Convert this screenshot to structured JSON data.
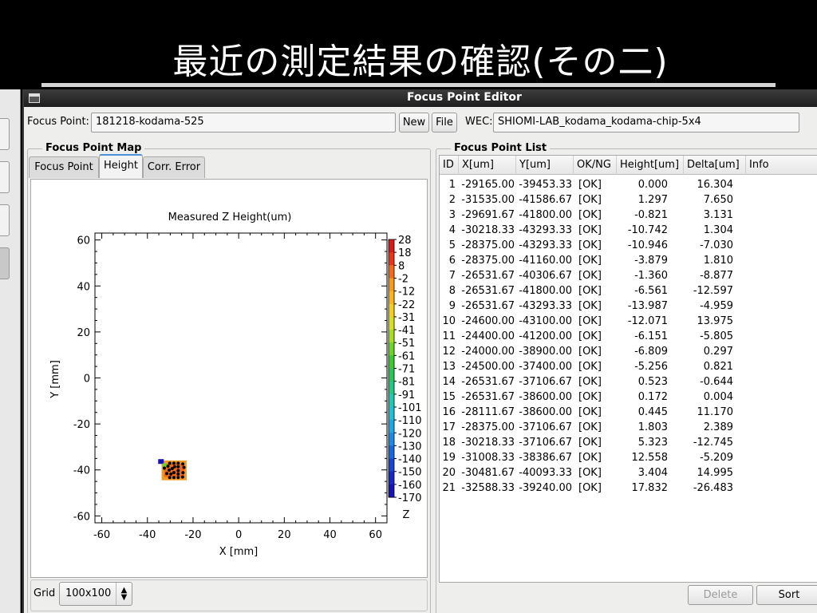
{
  "slide": {
    "title": "最近の測定結果の確認(その二)"
  },
  "window": {
    "title": "Focus Point Editor"
  },
  "toolbar": {
    "focus_point_label": "Focus Point:",
    "focus_point_value": "181218-kodama-525",
    "new_label": "New",
    "file_label": "File",
    "wec_label": "WEC:",
    "wec_value": "SHIOMI-LAB_kodama_kodama-chip-5x4"
  },
  "map_panel": {
    "title": "Focus Point Map",
    "tabs": [
      "Focus Point",
      "Height",
      "Corr. Error"
    ],
    "active_tab": "Height",
    "grid_label": "Grid",
    "grid_value": "100x100"
  },
  "list_panel": {
    "title": "Focus Point List",
    "columns": [
      "ID",
      "X[um]",
      "Y[um]",
      "OK/NG",
      "Height[um]",
      "Delta[um]",
      "Info"
    ],
    "rows": [
      [
        "1",
        "-29165.00",
        "-39453.33",
        "[OK]",
        "0.000",
        "16.304",
        ""
      ],
      [
        "2",
        "-31535.00",
        "-41586.67",
        "[OK]",
        "1.297",
        "7.650",
        ""
      ],
      [
        "3",
        "-29691.67",
        "-41800.00",
        "[OK]",
        "-0.821",
        "3.131",
        ""
      ],
      [
        "4",
        "-30218.33",
        "-43293.33",
        "[OK]",
        "-10.742",
        "1.304",
        ""
      ],
      [
        "5",
        "-28375.00",
        "-43293.33",
        "[OK]",
        "-10.946",
        "-7.030",
        ""
      ],
      [
        "6",
        "-28375.00",
        "-41160.00",
        "[OK]",
        "-3.879",
        "1.810",
        ""
      ],
      [
        "7",
        "-26531.67",
        "-40306.67",
        "[OK]",
        "-1.360",
        "-8.877",
        ""
      ],
      [
        "8",
        "-26531.67",
        "-41800.00",
        "[OK]",
        "-6.561",
        "-12.597",
        ""
      ],
      [
        "9",
        "-26531.67",
        "-43293.33",
        "[OK]",
        "-13.987",
        "-4.959",
        ""
      ],
      [
        "10",
        "-24600.00",
        "-43100.00",
        "[OK]",
        "-12.071",
        "13.975",
        ""
      ],
      [
        "11",
        "-24400.00",
        "-41200.00",
        "[OK]",
        "-6.151",
        "-5.805",
        ""
      ],
      [
        "12",
        "-24000.00",
        "-38900.00",
        "[OK]",
        "-6.809",
        "0.297",
        ""
      ],
      [
        "13",
        "-24500.00",
        "-37400.00",
        "[OK]",
        "-5.256",
        "0.821",
        ""
      ],
      [
        "14",
        "-26531.67",
        "-37106.67",
        "[OK]",
        "0.523",
        "-0.644",
        ""
      ],
      [
        "15",
        "-26531.67",
        "-38600.00",
        "[OK]",
        "0.172",
        "0.004",
        ""
      ],
      [
        "16",
        "-28111.67",
        "-38600.00",
        "[OK]",
        "0.445",
        "11.170",
        ""
      ],
      [
        "17",
        "-28375.00",
        "-37106.67",
        "[OK]",
        "1.803",
        "2.389",
        ""
      ],
      [
        "18",
        "-30218.33",
        "-37106.67",
        "[OK]",
        "5.323",
        "-12.745",
        ""
      ],
      [
        "19",
        "-31008.33",
        "-38386.67",
        "[OK]",
        "12.558",
        "-5.209",
        ""
      ],
      [
        "20",
        "-30481.67",
        "-40093.33",
        "[OK]",
        "3.404",
        "14.995",
        ""
      ],
      [
        "21",
        "-32588.33",
        "-39240.00",
        "[OK]",
        "17.832",
        "-26.483",
        ""
      ]
    ],
    "delete_label": "Delete",
    "sort_label": "Sort"
  },
  "chart_data": {
    "type": "heatmap",
    "title": "Measured Z Height(um)",
    "xlabel": "X    [mm]",
    "ylabel": "Y    [mm]",
    "xlim": [
      -63,
      65
    ],
    "ylim": [
      -63,
      63
    ],
    "xticks": [
      -60,
      -40,
      -20,
      0,
      20,
      40,
      60
    ],
    "yticks": [
      60,
      40,
      20,
      0,
      -20,
      -40,
      -60
    ],
    "colorbar_label": "Z",
    "colorbar_ticks": [
      "28",
      "18",
      "8",
      "-2",
      "-12",
      "-22",
      "-31",
      "-41",
      "-51",
      "-61",
      "-71",
      "-81",
      "-91",
      "-101",
      "-110",
      "-120",
      "-130",
      "-140",
      "-150",
      "-160",
      "-170"
    ],
    "colorbar_colors": [
      "#d41a1a",
      "#e8351a",
      "#ef6a1e",
      "#f39a22",
      "#f7b524",
      "#f2cf26",
      "#d8de28",
      "#a8dc2a",
      "#6ed22e",
      "#3fc636",
      "#2fc25a",
      "#2ac487",
      "#27c4b0",
      "#26bcd2",
      "#22a6e0",
      "#1f88e0",
      "#1c66d8",
      "#1a44cc",
      "#1826c0",
      "#1614b0"
    ],
    "points": [
      {
        "x": -29.165,
        "y": -39.453
      },
      {
        "x": -31.535,
        "y": -41.587
      },
      {
        "x": -29.692,
        "y": -41.8
      },
      {
        "x": -30.218,
        "y": -43.293
      },
      {
        "x": -28.375,
        "y": -43.293
      },
      {
        "x": -28.375,
        "y": -41.16
      },
      {
        "x": -26.532,
        "y": -40.307
      },
      {
        "x": -26.532,
        "y": -41.8
      },
      {
        "x": -26.532,
        "y": -43.293
      },
      {
        "x": -24.6,
        "y": -43.1
      },
      {
        "x": -24.4,
        "y": -41.2
      },
      {
        "x": -24.0,
        "y": -38.9
      },
      {
        "x": -24.5,
        "y": -37.4
      },
      {
        "x": -26.532,
        "y": -37.107
      },
      {
        "x": -26.532,
        "y": -38.6
      },
      {
        "x": -28.112,
        "y": -38.6
      },
      {
        "x": -28.375,
        "y": -37.107
      },
      {
        "x": -30.218,
        "y": -37.107
      },
      {
        "x": -31.008,
        "y": -38.387
      },
      {
        "x": -30.482,
        "y": -40.093
      },
      {
        "x": -32.588,
        "y": -39.24
      }
    ]
  }
}
